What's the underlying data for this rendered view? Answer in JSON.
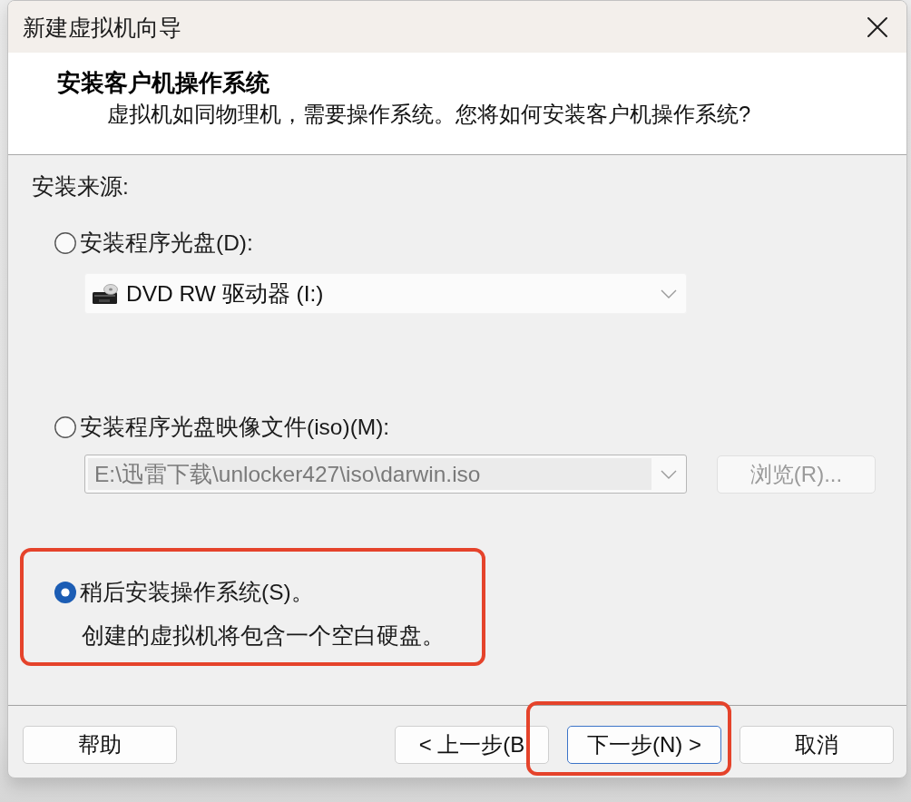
{
  "window": {
    "title": "新建虚拟机向导"
  },
  "header": {
    "title": "安装客户机操作系统",
    "subtitle": "虚拟机如同物理机，需要操作系统。您将如何安装客户机操作系统?"
  },
  "install_source": {
    "label": "安装来源:",
    "options": [
      {
        "kind": "disc",
        "label": "安装程序光盘(D):",
        "selected": false,
        "highlighted": false,
        "field": {
          "value": "DVD RW 驱动器 (I:)",
          "disabled": false
        }
      },
      {
        "kind": "iso",
        "label": "安装程序光盘映像文件(iso)(M):",
        "selected": false,
        "highlighted": false,
        "field": {
          "value": "E:\\迅雷下载\\unlocker427\\iso\\darwin.iso",
          "disabled": true
        },
        "browse_button": {
          "label": "浏览(R)...",
          "disabled": true
        }
      },
      {
        "kind": "later",
        "label": "稍后安装操作系统(S)。",
        "selected": true,
        "highlighted": true,
        "description": "创建的虚拟机将包含一个空白硬盘。"
      }
    ]
  },
  "buttons": [
    {
      "label": "帮助",
      "default": false,
      "highlighted": false
    },
    {
      "label": "< 上一步(B",
      "default": false,
      "highlighted": false
    },
    {
      "label": "下一步(N) >",
      "default": true,
      "highlighted": true
    },
    {
      "label": "取消",
      "default": false,
      "highlighted": false
    }
  ]
}
